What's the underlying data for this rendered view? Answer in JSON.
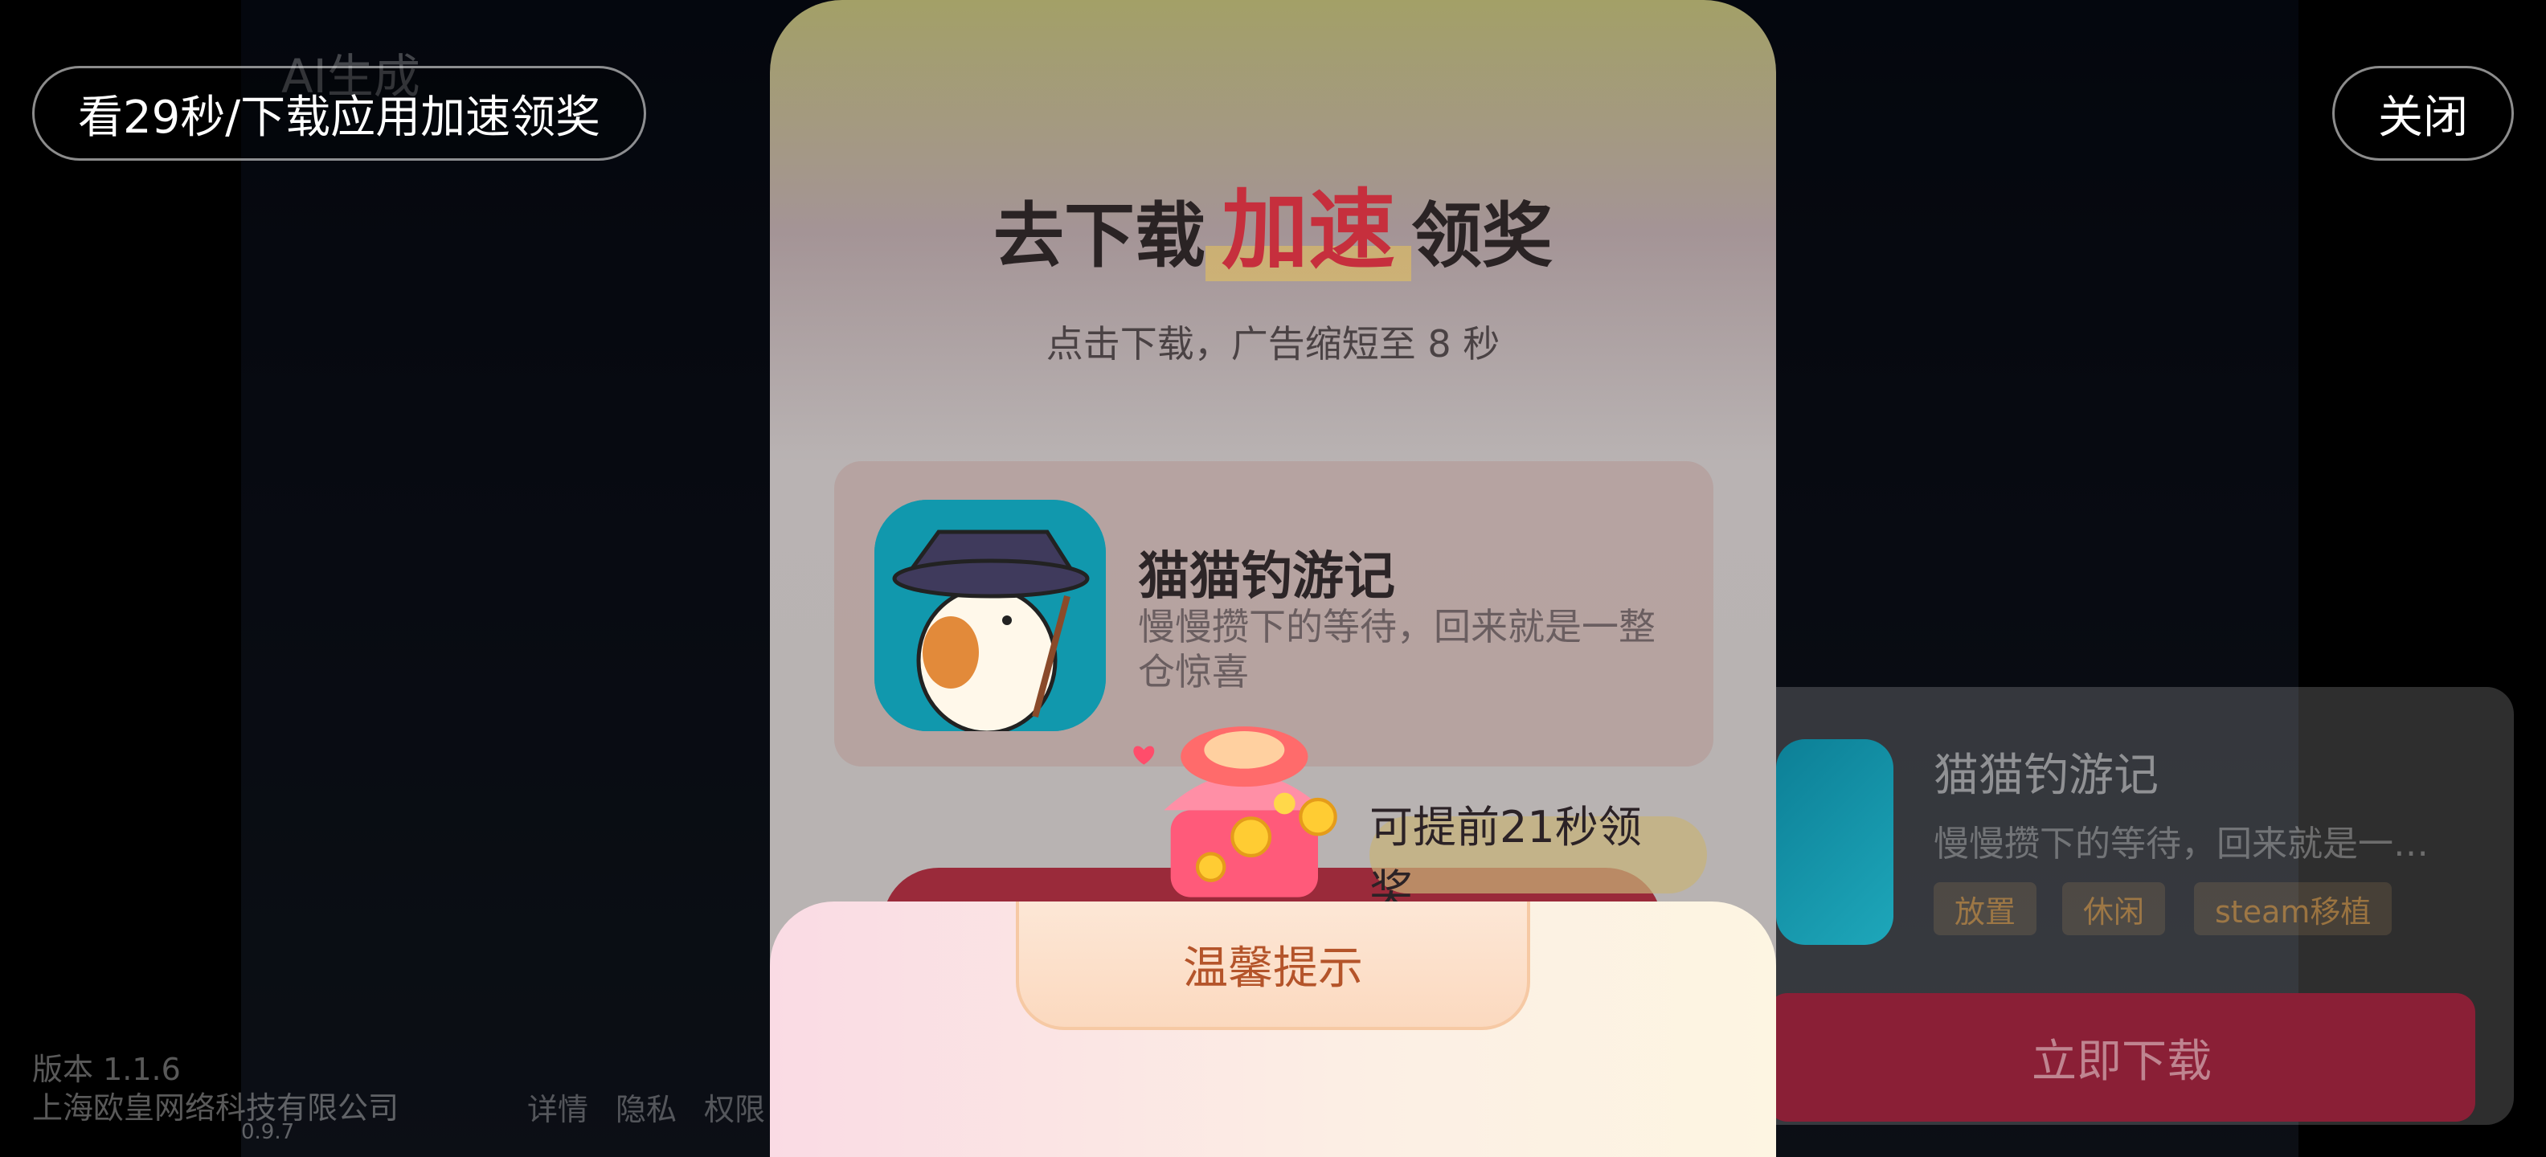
{
  "top": {
    "reward_hint": "看29秒/下载应用加速领奖",
    "close_label": "关闭",
    "ai_tag": "AI生成"
  },
  "footer": {
    "version": "版本 1.1.6",
    "company": "上海欧皇网络科技有限公司",
    "build": "0.9.7",
    "links": [
      "详情",
      "隐私",
      "权限"
    ]
  },
  "side_card": {
    "app_name": "猫猫钓游记",
    "desc": "慢慢攒下的等待，回来就是一整仓惊喜",
    "tags": [
      "放置",
      "休闲",
      "steam移植"
    ],
    "download_label": "立即下载"
  },
  "modal": {
    "title_prefix": "去下载",
    "title_highlight": "加速",
    "title_suffix": "领奖",
    "subtitle": "点击下载，广告缩短至 8 秒",
    "app_name": "猫猫钓游记",
    "app_desc": "慢慢攒下的等待，回来就是一整仓惊喜",
    "reward_badge": "可提前21秒领奖"
  },
  "sheet": {
    "tab_label": "温馨提示"
  },
  "colors": {
    "accent_red": "#c62f3d",
    "button_red": "#8a1f36",
    "tip_orange": "#b4542a"
  }
}
